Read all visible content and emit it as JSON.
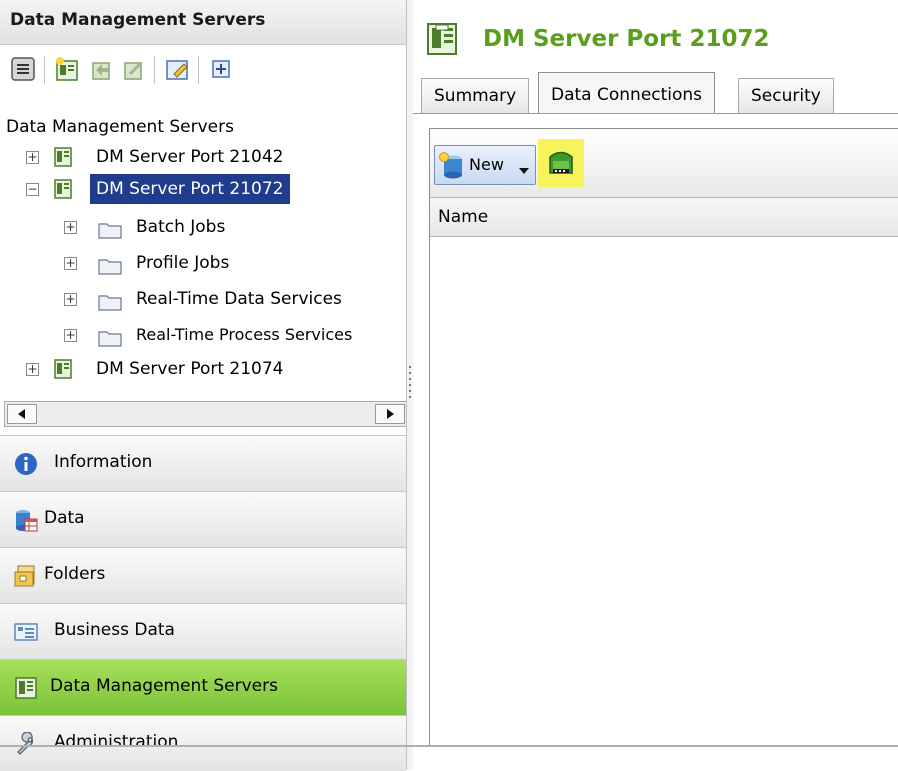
{
  "left_panel": {
    "title": "Data Management Servers",
    "toolbar_icons": [
      "collapse-icon",
      "new-server-icon",
      "import-icon",
      "export-icon",
      "edit-icon",
      "add-icon"
    ],
    "tree": {
      "root_label": "Data Management Servers",
      "servers": [
        {
          "label": "DM Server Port 21042",
          "expanded": false,
          "selected": false
        },
        {
          "label": "DM Server Port 21072",
          "expanded": true,
          "selected": true,
          "children": [
            "Batch Jobs",
            "Profile Jobs",
            "Real-Time Data Services",
            "Real-Time Process Services"
          ]
        },
        {
          "label": "DM Server Port 21074",
          "expanded": false,
          "selected": false
        }
      ]
    },
    "nav": [
      {
        "label": "Information",
        "icon": "info-icon"
      },
      {
        "label": "Data",
        "icon": "database-icon"
      },
      {
        "label": "Folders",
        "icon": "folders-icon"
      },
      {
        "label": "Business Data",
        "icon": "business-data-icon"
      },
      {
        "label": "Data Management Servers",
        "icon": "server-icon",
        "active": true
      },
      {
        "label": "Administration",
        "icon": "wrench-icon"
      }
    ]
  },
  "main": {
    "title": "DM Server Port 21072",
    "tabs": [
      {
        "label": "Summary",
        "active": false
      },
      {
        "label": "Data Connections",
        "active": true
      },
      {
        "label": "Security",
        "active": false
      }
    ],
    "toolbar": {
      "new_label": "New",
      "highlight_color": "#f7f35a"
    },
    "table": {
      "columns": [
        "Name"
      ],
      "rows": []
    }
  },
  "colors": {
    "accent_green": "#5a9e1e",
    "active_nav": "#8fd048",
    "selection": "#1f3d8c"
  }
}
